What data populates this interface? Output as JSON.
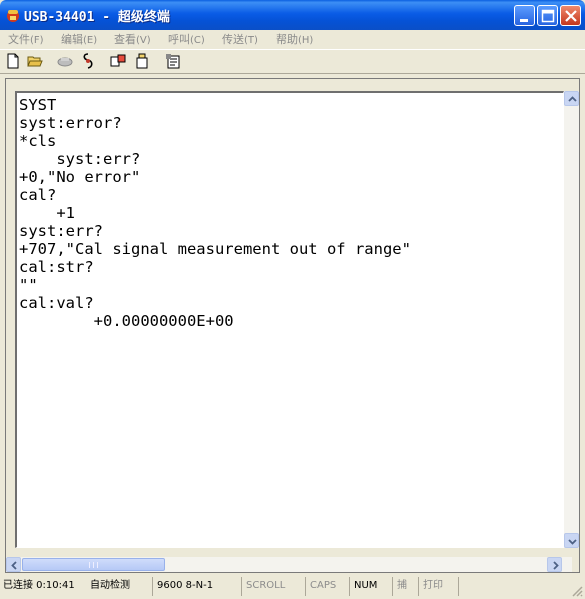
{
  "window": {
    "title": "USB-34401 - 超级终端",
    "icon": "hyperterminal-phone-icon"
  },
  "menu": {
    "items": [
      {
        "label": "文件",
        "key": "(F)"
      },
      {
        "label": "编辑",
        "key": "(E)"
      },
      {
        "label": "查看",
        "key": "(V)"
      },
      {
        "label": "呼叫",
        "key": "(C)"
      },
      {
        "label": "传送",
        "key": "(T)"
      },
      {
        "label": "帮助",
        "key": "(H)"
      }
    ]
  },
  "toolbar": {
    "icons": [
      "new-icon",
      "open-icon",
      "connect-icon",
      "disconnect-icon",
      "send-icon",
      "receive-icon",
      "properties-icon"
    ]
  },
  "terminal": {
    "lines": [
      "SYST",
      "syst:error?",
      "*cls",
      "    syst:err?",
      "+0,\"No error\"",
      "cal?",
      "    +1",
      "syst:err?",
      "+707,\"Cal signal measurement out of range\"",
      "cal:str?",
      "\"\"",
      "cal:val?",
      "        +0.00000000E+00"
    ]
  },
  "status": {
    "connection": "已连接 0:10:41",
    "detect": "自动检测",
    "settings": "9600 8-N-1",
    "scroll": "SCROLL",
    "caps": "CAPS",
    "num": "NUM",
    "capture": "捕",
    "print": "打印"
  },
  "colors": {
    "titlebar": "#0a5ce6",
    "chrome": "#ece9d8",
    "terminal_bg": "#ffffff",
    "scroll_button": "#c9d6f3"
  }
}
